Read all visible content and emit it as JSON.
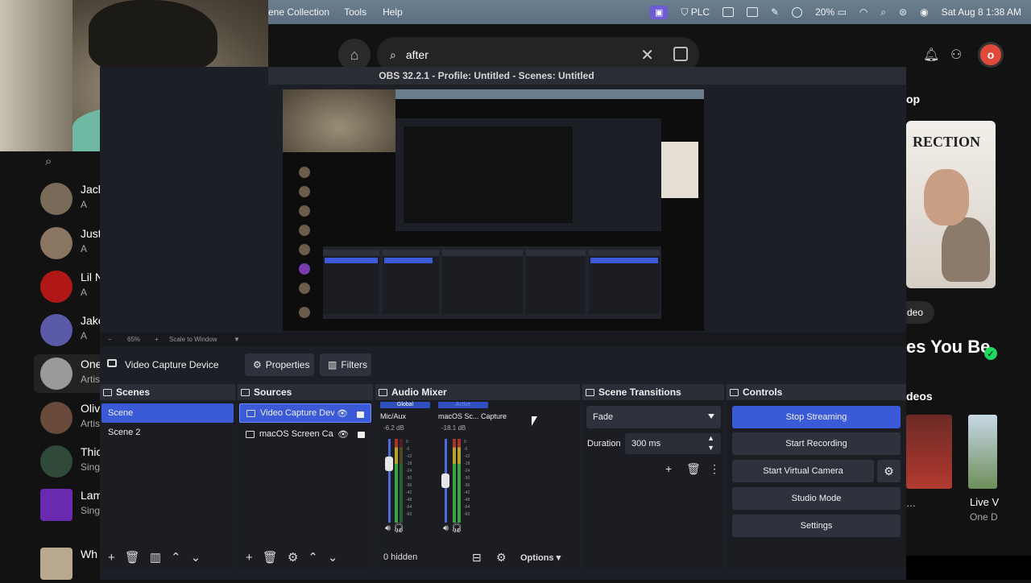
{
  "menubar": {
    "app_menus": [
      "ene Collection",
      "Tools",
      "Help"
    ],
    "plc_label": "PLC",
    "battery": "20%",
    "clock": "Sat Aug 8  1:38 AM"
  },
  "spotify": {
    "search_value": "after",
    "profile_initial": "o",
    "sidebar": [
      {
        "name": "Jacl",
        "sub": "A"
      },
      {
        "name": "Just",
        "sub": "A"
      },
      {
        "name": "Lil N",
        "sub": "A"
      },
      {
        "name": "Jake",
        "sub": "A"
      },
      {
        "name": "One",
        "sub": "Artis"
      },
      {
        "name": "Olivi",
        "sub": "Artis"
      },
      {
        "name": "Thic",
        "sub": "Sing"
      },
      {
        "name": "Lam",
        "sub": "Sing"
      },
      {
        "name": "Wh",
        "sub": ""
      }
    ],
    "right_panel": {
      "top_label": "op",
      "card_text": "RECTION",
      "video_pill": "deo",
      "heading": "es You Be",
      "videos_label": "deos",
      "video1_title": "…",
      "video2_title": "Live V",
      "video2_sub": "One D"
    }
  },
  "obs": {
    "window_title": "OBS 32.2.1 - Profile: Untitled - Scenes: Untitled",
    "preview_controls": {
      "zoom": "65%",
      "scale": "Scale to Window"
    },
    "context": {
      "source_name": "Video Capture Device",
      "properties_label": "Properties",
      "filters_label": "Filters"
    },
    "scenes": {
      "title": "Scenes",
      "items": [
        "Scene",
        "Scene 2"
      ],
      "selected": 0
    },
    "sources": {
      "title": "Sources",
      "items": [
        {
          "name": "Video Capture Devi",
          "selected": true
        },
        {
          "name": "macOS Screen Capt",
          "selected": false
        }
      ]
    },
    "audio_mixer": {
      "title": "Audio Mixer",
      "channels": [
        {
          "tag": "Global",
          "name": "Mic/Aux",
          "db": "-6.2 dB",
          "fader": 0.75
        },
        {
          "tag": "Active",
          "name": "macOS Sc... Capture",
          "db": "-18.1 dB",
          "fader": 0.5
        }
      ],
      "scale_ticks": [
        "0",
        "-6",
        "-12",
        "-18",
        "-24",
        "-30",
        "-36",
        "-42",
        "-48",
        "-54",
        "-60"
      ],
      "hidden_label": "0 hidden",
      "options_label": "Options"
    },
    "scene_transitions": {
      "title": "Scene Transitions",
      "transition": "Fade",
      "duration_label": "Duration",
      "duration_value": "300 ms"
    },
    "controls": {
      "title": "Controls",
      "buttons": [
        "Stop Streaming",
        "Start Recording",
        "Start Virtual Camera",
        "Studio Mode",
        "Settings"
      ]
    }
  },
  "colors": {
    "accent_blue": "#3b5ad8",
    "spotify_green": "#1ed760",
    "obs_bg": "#1d1f26"
  }
}
